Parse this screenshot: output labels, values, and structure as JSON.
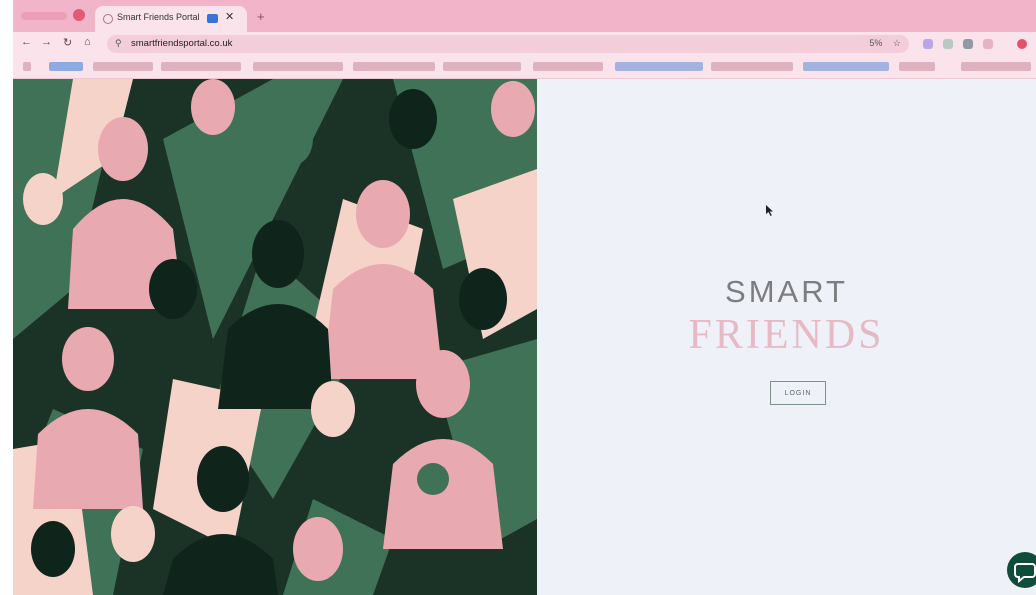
{
  "browser": {
    "tab_title": "Smart Friends Portal",
    "url": "smartfriendsportal.co.uk",
    "zoom": "5%"
  },
  "page": {
    "brand_line1": "SMART",
    "brand_line2": "FRIENDS",
    "login_label": "LOGIN"
  },
  "colors": {
    "browser_chrome": "#f4b9cc",
    "panel_bg": "#eff1f9",
    "art_dark": "#1b3227",
    "art_green": "#3f7256",
    "art_pink": "#e9a9b0",
    "art_light": "#f6d3c9",
    "chat_button": "#0f4d3a"
  },
  "icons": [
    "record-icon",
    "favicon-icon",
    "media-icon",
    "close-icon",
    "plus-icon",
    "back-icon",
    "forward-icon",
    "reload-icon",
    "home-icon",
    "site-info-icon",
    "star-icon",
    "chat-icon"
  ]
}
